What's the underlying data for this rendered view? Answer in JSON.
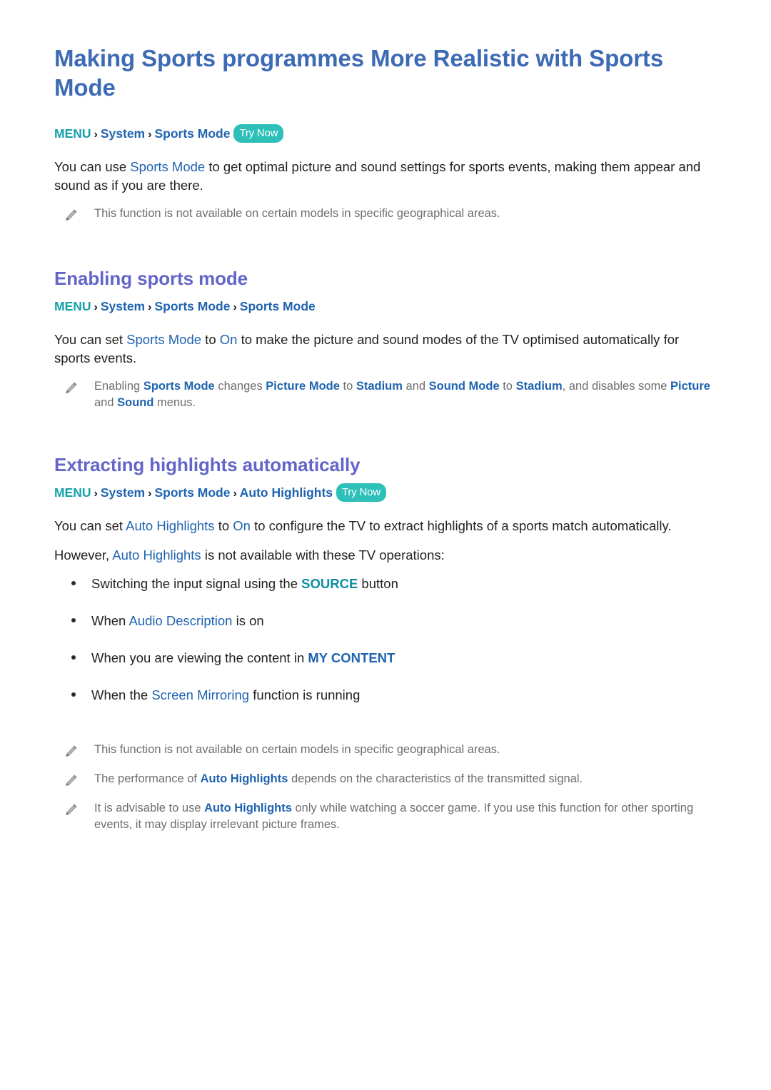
{
  "document": {
    "title": "Making Sports programmes More Realistic with Sports Mode",
    "top_breadcrumb": {
      "menu_label": "MENU",
      "separator": "›",
      "items": [
        "System",
        "Sports Mode"
      ],
      "badge": "Try Now"
    },
    "intro_paragraph": {
      "before": "You can use ",
      "keyword": "Sports Mode",
      "after": " to get optimal picture and sound settings for sports events, making them appear and sound as if you are there."
    },
    "intro_note": "This function is not available on certain models in specific geographical areas."
  },
  "section_enabling": {
    "heading": "Enabling sports mode",
    "breadcrumb": {
      "menu_label": "MENU",
      "separator": "›",
      "items": [
        "System",
        "Sports Mode",
        "Sports Mode"
      ]
    },
    "paragraph": {
      "p1": "You can set ",
      "k1": "Sports Mode",
      "p2": " to ",
      "k2": "On",
      "p3": " to make the picture and sound modes of the TV optimised automatically for sports events."
    },
    "note": {
      "n1": "Enabling ",
      "k1": "Sports Mode",
      "n2": " changes ",
      "k2": "Picture Mode",
      "n3": " to ",
      "k3": "Stadium",
      "n4": " and ",
      "k4": "Sound Mode",
      "n5": " to ",
      "k5": "Stadium",
      "n6": ", and disables some ",
      "k6": "Picture",
      "n7": " and ",
      "k7": "Sound",
      "n8": " menus."
    }
  },
  "section_extracting": {
    "heading": "Extracting highlights automatically",
    "breadcrumb": {
      "menu_label": "MENU",
      "separator": "›",
      "items": [
        "System",
        "Sports Mode",
        "Auto Highlights"
      ],
      "badge": "Try Now"
    },
    "paragraph": {
      "p1": "You can set ",
      "k1": "Auto Highlights",
      "p2": " to ",
      "k2": "On",
      "p3": " to configure the TV to extract highlights of a sports match automatically."
    },
    "lead_in": {
      "p1": "However, ",
      "k1": "Auto Highlights",
      "p2": " is not available with these TV operations:"
    },
    "bullets": [
      {
        "p1": "Switching the input signal using the ",
        "k1": "SOURCE",
        "k1_style": "teal",
        "p2": " button"
      },
      {
        "p1": "When ",
        "k1": "Audio Description",
        "k1_style": "blue",
        "p2": " is on"
      },
      {
        "p1": "When you are viewing the content in ",
        "k1": "MY CONTENT",
        "k1_style": "blue-bold",
        "p2": ""
      },
      {
        "p1": "When the ",
        "k1": "Screen Mirroring",
        "k1_style": "blue",
        "p2": " function is running"
      }
    ],
    "notes": [
      {
        "n1": "This function is not available on certain models in specific geographical areas.",
        "k1": "",
        "n2": ""
      },
      {
        "n1": "The performance of ",
        "k1": "Auto Highlights",
        "n2": " depends on the characteristics of the transmitted signal."
      },
      {
        "n1": "It is advisable to use ",
        "k1": "Auto Highlights",
        "n2": " only while watching a soccer game. If you use this function for other sporting events, it may display irrelevant picture frames."
      }
    ]
  },
  "colors": {
    "title_blue": "#3c6ab5",
    "heading_purple": "#6366c8",
    "keyword_blue": "#1f63b0",
    "menu_teal": "#12a0ab",
    "badge_teal": "#2cc0b8",
    "note_grey": "#6e6e72",
    "body_black": "#231f20"
  }
}
